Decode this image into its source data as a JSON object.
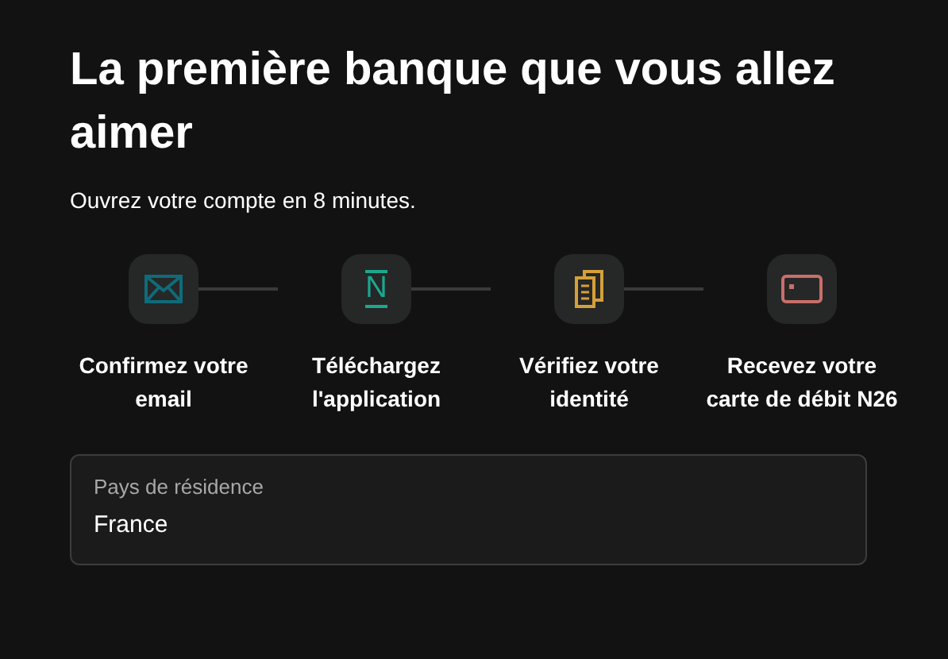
{
  "title": "La première banque que vous allez aimer",
  "subtitle": "Ouvrez votre compte en 8 minutes.",
  "steps": [
    {
      "kind": "email",
      "label": "Confirmez votre email"
    },
    {
      "kind": "app",
      "glyph": "N",
      "label": "Téléchargez l'application"
    },
    {
      "kind": "documents",
      "label": "Vérifiez votre identité"
    },
    {
      "kind": "card",
      "label": "Recevez votre carte de débit N26"
    }
  ],
  "country_field": {
    "label": "Pays de résidence",
    "value": "France"
  }
}
